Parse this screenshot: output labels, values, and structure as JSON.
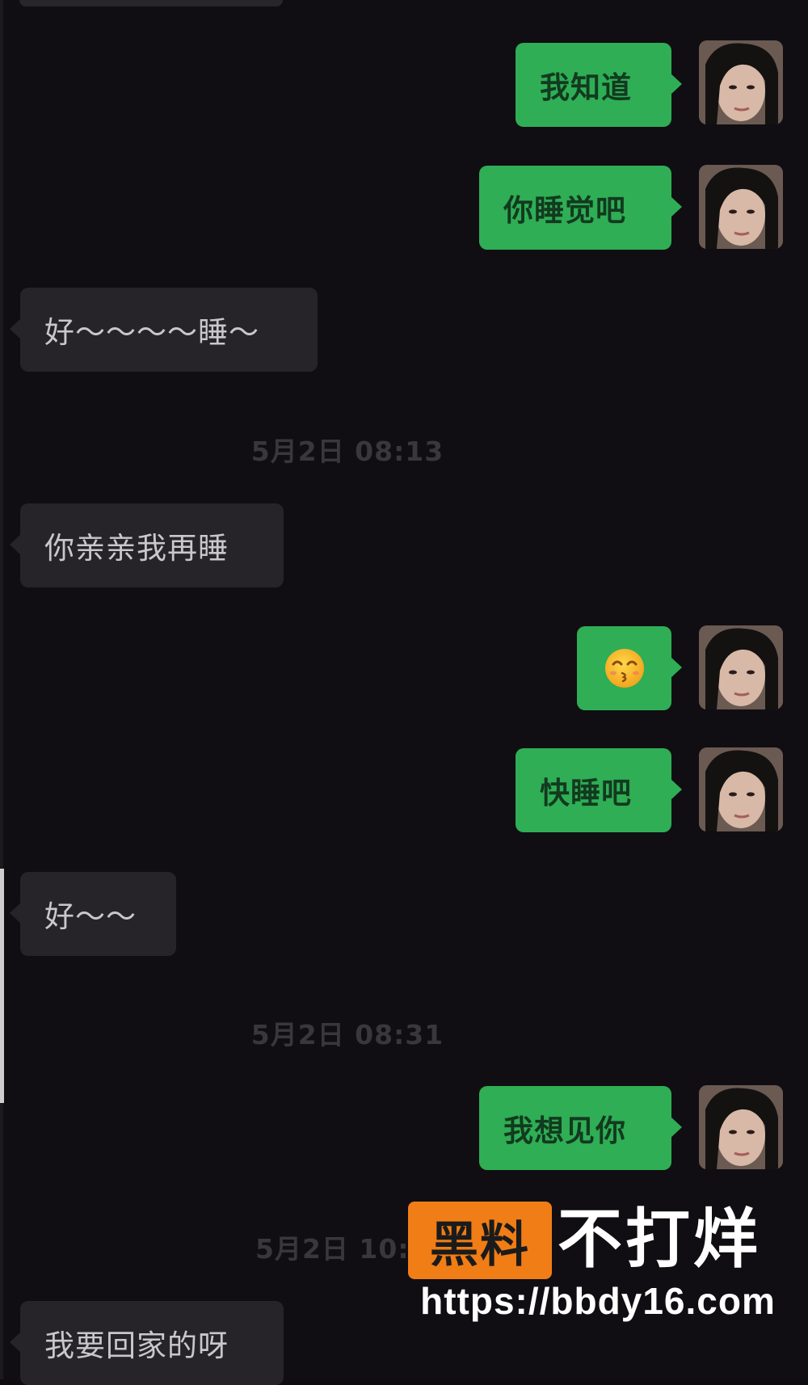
{
  "messages": [
    {
      "text": "我知道"
    },
    {
      "text": "你睡觉吧"
    },
    {
      "text": "好～～～～睡～"
    },
    {
      "text": "你亲亲我再睡"
    },
    {
      "emoji": "kissing-face-icon"
    },
    {
      "text": "快睡吧"
    },
    {
      "text": "好～～"
    },
    {
      "text": "我想见你"
    },
    {
      "text": "我要回家的呀"
    }
  ],
  "timestamps": [
    "5月2日 08:13",
    "5月2日 08:31",
    "5月2日 10:"
  ],
  "watermark": {
    "badge": "黑料",
    "text": "不打烊",
    "url": "https://bbdy16.com",
    "badge_color": "#f07d16"
  },
  "colors": {
    "background": "#100e13",
    "outgoing_bubble": "#2fae55",
    "incoming_bubble": "#262428"
  }
}
